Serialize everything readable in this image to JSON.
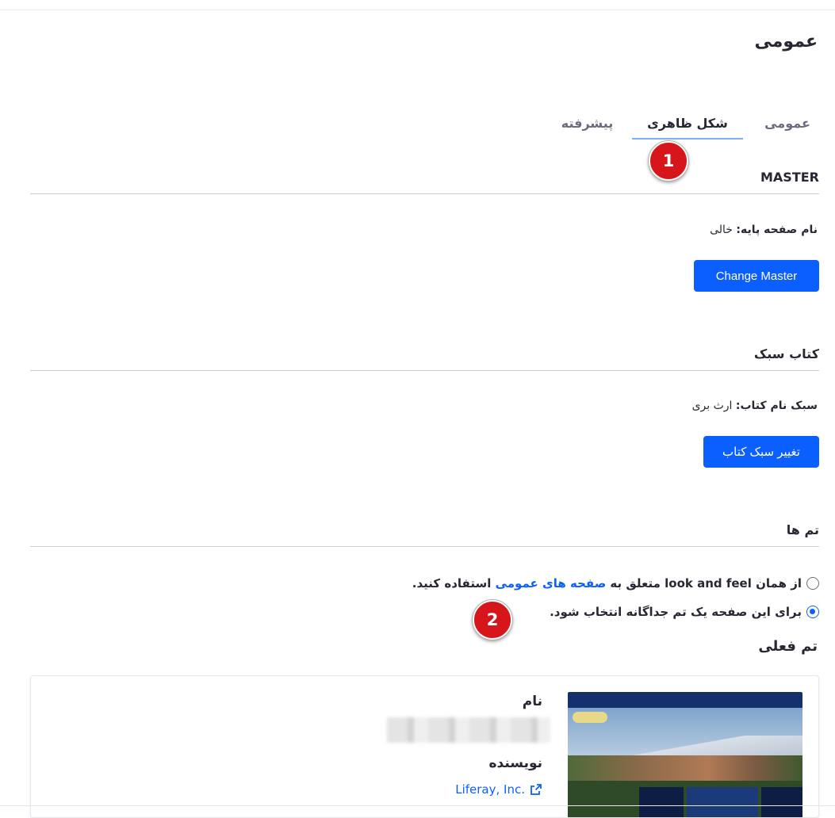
{
  "page": {
    "title": "عمومی"
  },
  "tabs": [
    {
      "label": "عمومی"
    },
    {
      "label": "شکل ظاهری"
    },
    {
      "label": "پیشرفته"
    }
  ],
  "markers": [
    "1",
    "2"
  ],
  "master": {
    "heading": "MASTER",
    "field_label": "نام صفحه پایه:",
    "field_value": "خالی",
    "button_label": "Change Master"
  },
  "stylebook": {
    "heading": "کتاب سبک",
    "field_label": "سبک نام کتاب:",
    "field_value": "ارث بری",
    "button_label": "تغییر سبک کتاب"
  },
  "themes": {
    "heading": "تم ها",
    "option_inherit": {
      "prefix": "از همان",
      "look_feel": "look and feel",
      "middle": "متعلق به",
      "link": "صفحه های عمومی",
      "suffix": "استفاده کنید."
    },
    "option_specific": "برای این صفحه یک تم جداگانه انتخاب شود.",
    "selected": "specific",
    "current_heading": "تم فعلی",
    "card": {
      "name_label": "نام",
      "author_label": "نویسنده",
      "author_value": "Liferay, Inc."
    }
  },
  "colors": {
    "primary": "#0b5fff",
    "marker": "#d7161b",
    "text": "#272833"
  },
  "icons": {
    "radio": "radio-button-icon",
    "external": "external-link-icon"
  }
}
